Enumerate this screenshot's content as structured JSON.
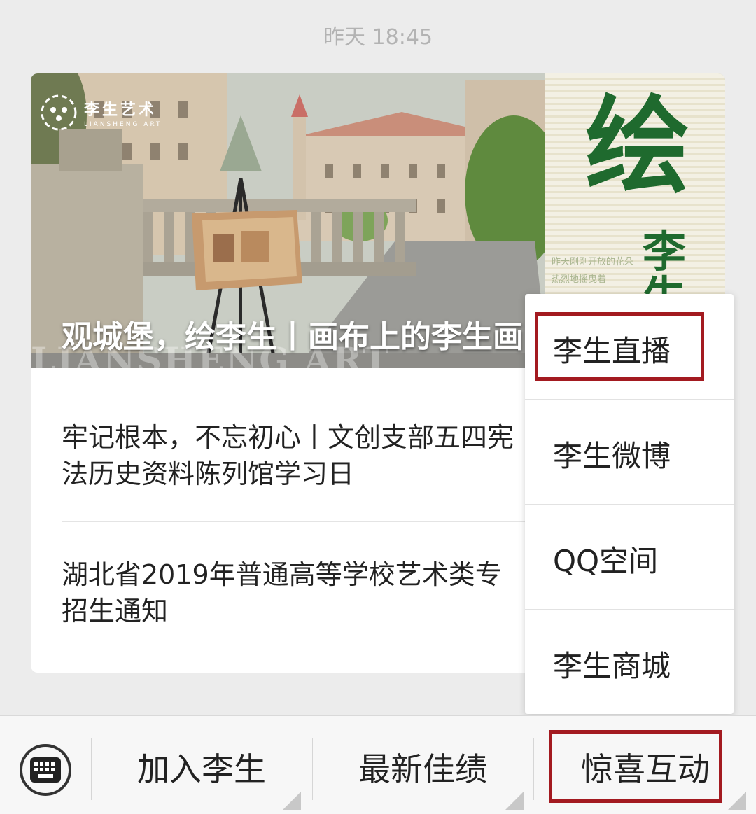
{
  "timestamp": "昨天 18:45",
  "article_card": {
    "logo": {
      "name_cn": "李生艺术",
      "name_en": "LIANSHENG ART"
    },
    "headline": "观城堡，绘李生丨画布上的李生画",
    "watermark": "LIANSHENG ART",
    "side_poster": {
      "big_char": "绘",
      "small_chars": "李生",
      "note_lines": [
        "昨天刚刚开放的花朵",
        "热烈地摇曳着"
      ]
    },
    "articles": [
      {
        "title_line1": "牢记根本，不忘初心丨文创支部五四宪",
        "title_line2": "法历史资料陈列馆学习日"
      },
      {
        "title_line1": "湖北省2019年普通高等学校艺术类专",
        "title_line2": "招生通知"
      }
    ]
  },
  "popup_menu": {
    "items": [
      "李生直播",
      "李生微博",
      "QQ空间",
      "李生商城"
    ],
    "highlighted_item": "李生直播"
  },
  "bottom_menu": {
    "items": [
      "加入李生",
      "最新佳绩",
      "惊喜互动"
    ],
    "highlighted_item": "惊喜互动"
  },
  "icons": [
    "keyboard-icon",
    "menu-corner-icon",
    "logo-icon"
  ],
  "colors": {
    "highlight_border": "#a31a20",
    "poster_green": "#1f6a2e"
  }
}
